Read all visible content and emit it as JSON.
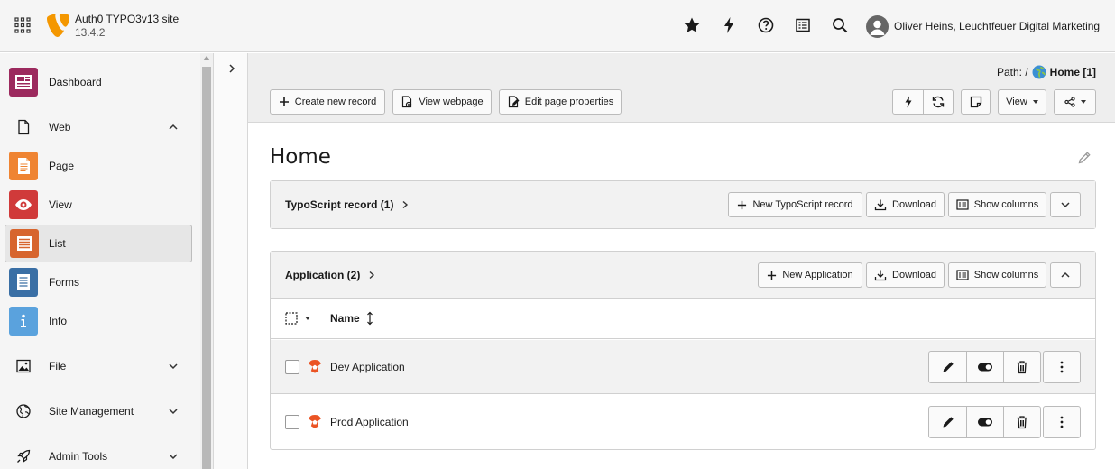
{
  "topbar": {
    "site_name": "Auth0 TYPO3v13 site",
    "site_version": "13.4.2",
    "user_name": "Oliver Heins, Leuchtfeuer Digital Marketing",
    "icons": [
      "bookmark-star-icon",
      "flash-clear-cache-icon",
      "help-icon",
      "system-information-icon",
      "search-icon"
    ]
  },
  "sidebar": {
    "items": [
      {
        "label": "Dashboard",
        "icon": "dashboard-icon",
        "color": "#9c2a5e"
      },
      {
        "label": "Web",
        "icon": "page-outline-icon",
        "group": true,
        "expanded": true
      },
      {
        "label": "Page",
        "icon": "page-module-icon",
        "color": "#ef8432"
      },
      {
        "label": "View",
        "icon": "eye-icon",
        "color": "#d03a3a"
      },
      {
        "label": "List",
        "icon": "list-icon",
        "color": "#d7652e",
        "active": true
      },
      {
        "label": "Forms",
        "icon": "form-icon",
        "color": "#3a6fa5"
      },
      {
        "label": "Info",
        "icon": "info-icon",
        "color": "#5aa2dd"
      },
      {
        "label": "File",
        "icon": "image-icon",
        "group": true,
        "expanded": false
      },
      {
        "label": "Site Management",
        "icon": "globe-icon",
        "group": true,
        "expanded": false
      },
      {
        "label": "Admin Tools",
        "icon": "rocket-icon",
        "group": true,
        "expanded": false
      }
    ]
  },
  "module_header": {
    "path_label": "Path: /",
    "path_page": "Home [1]",
    "create_new_record": "Create new record",
    "view_webpage": "View webpage",
    "edit_page_properties": "Edit page properties",
    "view_label": "View"
  },
  "content": {
    "page_title": "Home",
    "panels": [
      {
        "title": "TypoScript record (1)",
        "new_label": "New TypoScript record",
        "download_label": "Download",
        "show_columns_label": "Show columns",
        "expanded": false
      },
      {
        "title": "Application (2)",
        "new_label": "New Application",
        "download_label": "Download",
        "show_columns_label": "Show columns",
        "expanded": true,
        "column_header": "Name",
        "rows": [
          {
            "name": "Dev Application"
          },
          {
            "name": "Prod Application"
          }
        ]
      }
    ]
  },
  "colors": {
    "auth0_orange": "#eb5424",
    "typo3_orange": "#f49700"
  }
}
